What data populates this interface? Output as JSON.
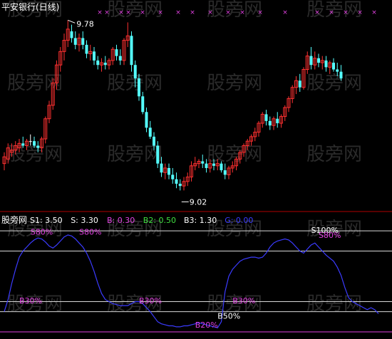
{
  "colors": {
    "background": "#000000",
    "up_candle": "#ff3030",
    "down_candle": "#54ffff",
    "doji": "#ffffff",
    "ind_line": "#3b3bff",
    "ref_line": "#d8d8d8",
    "magenta": "#e040e0",
    "separator": "#b00000",
    "watermark": "#2a2a2a"
  },
  "watermark_text": "股旁网",
  "chart_data": [
    {
      "type": "candlestick",
      "title": "平安银行(日线)",
      "annotations": {
        "high_label": "9.78",
        "low_label": "9.02"
      },
      "top_markers": "×",
      "candles": [
        {
          "o": 9.14,
          "h": 9.19,
          "l": 9.11,
          "c": 9.17
        },
        {
          "o": 9.16,
          "h": 9.23,
          "l": 9.14,
          "c": 9.21
        },
        {
          "o": 9.19,
          "h": 9.23,
          "l": 9.17,
          "c": 9.2
        },
        {
          "o": 9.2,
          "h": 9.24,
          "l": 9.18,
          "c": 9.22
        },
        {
          "o": 9.21,
          "h": 9.25,
          "l": 9.19,
          "c": 9.23
        },
        {
          "o": 9.23,
          "h": 9.26,
          "l": 9.21,
          "c": 9.22
        },
        {
          "o": 9.22,
          "h": 9.25,
          "l": 9.2,
          "c": 9.24
        },
        {
          "o": 9.24,
          "h": 9.27,
          "l": 9.22,
          "c": 9.24
        },
        {
          "o": 9.24,
          "h": 9.26,
          "l": 9.21,
          "c": 9.22
        },
        {
          "o": 9.22,
          "h": 9.24,
          "l": 9.19,
          "c": 9.21
        },
        {
          "o": 9.21,
          "h": 9.26,
          "l": 9.19,
          "c": 9.25
        },
        {
          "o": 9.25,
          "h": 9.35,
          "l": 9.23,
          "c": 9.34
        },
        {
          "o": 9.34,
          "h": 9.42,
          "l": 9.32,
          "c": 9.4
        },
        {
          "o": 9.4,
          "h": 9.52,
          "l": 9.38,
          "c": 9.5
        },
        {
          "o": 9.5,
          "h": 9.6,
          "l": 9.47,
          "c": 9.58
        },
        {
          "o": 9.58,
          "h": 9.66,
          "l": 9.55,
          "c": 9.64
        },
        {
          "o": 9.64,
          "h": 9.72,
          "l": 9.6,
          "c": 9.69
        },
        {
          "o": 9.69,
          "h": 9.78,
          "l": 9.66,
          "c": 9.74
        },
        {
          "o": 9.73,
          "h": 9.76,
          "l": 9.68,
          "c": 9.7
        },
        {
          "o": 9.7,
          "h": 9.73,
          "l": 9.65,
          "c": 9.67
        },
        {
          "o": 9.67,
          "h": 9.72,
          "l": 9.64,
          "c": 9.7
        },
        {
          "o": 9.7,
          "h": 9.73,
          "l": 9.65,
          "c": 9.67
        },
        {
          "o": 9.67,
          "h": 9.69,
          "l": 9.61,
          "c": 9.63
        },
        {
          "o": 9.63,
          "h": 9.67,
          "l": 9.6,
          "c": 9.64
        },
        {
          "o": 9.64,
          "h": 9.66,
          "l": 9.58,
          "c": 9.6
        },
        {
          "o": 9.6,
          "h": 9.62,
          "l": 9.56,
          "c": 9.58
        },
        {
          "o": 9.58,
          "h": 9.61,
          "l": 9.55,
          "c": 9.59
        },
        {
          "o": 9.59,
          "h": 9.62,
          "l": 9.56,
          "c": 9.58
        },
        {
          "o": 9.58,
          "h": 9.61,
          "l": 9.56,
          "c": 9.6
        },
        {
          "o": 9.6,
          "h": 9.66,
          "l": 9.58,
          "c": 9.65
        },
        {
          "o": 9.65,
          "h": 9.67,
          "l": 9.6,
          "c": 9.62
        },
        {
          "o": 9.62,
          "h": 9.65,
          "l": 9.58,
          "c": 9.6
        },
        {
          "o": 9.6,
          "h": 9.7,
          "l": 9.58,
          "c": 9.69
        },
        {
          "o": 9.69,
          "h": 9.77,
          "l": 9.66,
          "c": 9.71
        },
        {
          "o": 9.71,
          "h": 9.73,
          "l": 9.55,
          "c": 9.58
        },
        {
          "o": 9.58,
          "h": 9.6,
          "l": 9.48,
          "c": 9.52
        },
        {
          "o": 9.52,
          "h": 9.54,
          "l": 9.42,
          "c": 9.44
        },
        {
          "o": 9.44,
          "h": 9.46,
          "l": 9.36,
          "c": 9.37
        },
        {
          "o": 9.37,
          "h": 9.39,
          "l": 9.28,
          "c": 9.3
        },
        {
          "o": 9.3,
          "h": 9.33,
          "l": 9.25,
          "c": 9.26
        },
        {
          "o": 9.26,
          "h": 9.28,
          "l": 9.2,
          "c": 9.22
        },
        {
          "o": 9.22,
          "h": 9.24,
          "l": 9.12,
          "c": 9.14
        },
        {
          "o": 9.14,
          "h": 9.17,
          "l": 9.08,
          "c": 9.1
        },
        {
          "o": 9.1,
          "h": 9.14,
          "l": 9.07,
          "c": 9.12
        },
        {
          "o": 9.12,
          "h": 9.14,
          "l": 9.07,
          "c": 9.09
        },
        {
          "o": 9.09,
          "h": 9.12,
          "l": 9.05,
          "c": 9.07
        },
        {
          "o": 9.07,
          "h": 9.1,
          "l": 9.03,
          "c": 9.05
        },
        {
          "o": 9.05,
          "h": 9.07,
          "l": 9.02,
          "c": 9.04
        },
        {
          "o": 9.04,
          "h": 9.08,
          "l": 9.02,
          "c": 9.06
        },
        {
          "o": 9.06,
          "h": 9.1,
          "l": 9.04,
          "c": 9.08
        },
        {
          "o": 9.08,
          "h": 9.15,
          "l": 9.06,
          "c": 9.13
        },
        {
          "o": 9.13,
          "h": 9.17,
          "l": 9.11,
          "c": 9.14
        },
        {
          "o": 9.14,
          "h": 9.16,
          "l": 9.12,
          "c": 9.15
        },
        {
          "o": 9.15,
          "h": 9.18,
          "l": 9.12,
          "c": 9.14
        },
        {
          "o": 9.14,
          "h": 9.16,
          "l": 9.1,
          "c": 9.12
        },
        {
          "o": 9.12,
          "h": 9.16,
          "l": 9.1,
          "c": 9.14
        },
        {
          "o": 9.14,
          "h": 9.16,
          "l": 9.11,
          "c": 9.13
        },
        {
          "o": 9.13,
          "h": 9.16,
          "l": 9.11,
          "c": 9.14
        },
        {
          "o": 9.14,
          "h": 9.15,
          "l": 9.1,
          "c": 9.11
        },
        {
          "o": 9.11,
          "h": 9.14,
          "l": 9.07,
          "c": 9.09
        },
        {
          "o": 9.09,
          "h": 9.13,
          "l": 9.07,
          "c": 9.12
        },
        {
          "o": 9.12,
          "h": 9.15,
          "l": 9.1,
          "c": 9.13
        },
        {
          "o": 9.13,
          "h": 9.17,
          "l": 9.11,
          "c": 9.16
        },
        {
          "o": 9.16,
          "h": 9.2,
          "l": 9.14,
          "c": 9.19
        },
        {
          "o": 9.19,
          "h": 9.23,
          "l": 9.17,
          "c": 9.22
        },
        {
          "o": 9.22,
          "h": 9.25,
          "l": 9.2,
          "c": 9.24
        },
        {
          "o": 9.24,
          "h": 9.27,
          "l": 9.22,
          "c": 9.26
        },
        {
          "o": 9.26,
          "h": 9.3,
          "l": 9.24,
          "c": 9.28
        },
        {
          "o": 9.28,
          "h": 9.33,
          "l": 9.26,
          "c": 9.32
        },
        {
          "o": 9.32,
          "h": 9.37,
          "l": 9.3,
          "c": 9.36
        },
        {
          "o": 9.36,
          "h": 9.38,
          "l": 9.31,
          "c": 9.33
        },
        {
          "o": 9.33,
          "h": 9.35,
          "l": 9.29,
          "c": 9.31
        },
        {
          "o": 9.31,
          "h": 9.35,
          "l": 9.29,
          "c": 9.34
        },
        {
          "o": 9.34,
          "h": 9.37,
          "l": 9.3,
          "c": 9.32
        },
        {
          "o": 9.32,
          "h": 9.36,
          "l": 9.3,
          "c": 9.35
        },
        {
          "o": 9.35,
          "h": 9.4,
          "l": 9.33,
          "c": 9.39
        },
        {
          "o": 9.39,
          "h": 9.44,
          "l": 9.37,
          "c": 9.43
        },
        {
          "o": 9.43,
          "h": 9.49,
          "l": 9.41,
          "c": 9.48
        },
        {
          "o": 9.48,
          "h": 9.53,
          "l": 9.45,
          "c": 9.51
        },
        {
          "o": 9.51,
          "h": 9.54,
          "l": 9.46,
          "c": 9.48
        },
        {
          "o": 9.48,
          "h": 9.57,
          "l": 9.47,
          "c": 9.56
        },
        {
          "o": 9.56,
          "h": 9.64,
          "l": 9.54,
          "c": 9.62
        },
        {
          "o": 9.62,
          "h": 9.66,
          "l": 9.56,
          "c": 9.58
        },
        {
          "o": 9.58,
          "h": 9.64,
          "l": 9.56,
          "c": 9.61
        },
        {
          "o": 9.61,
          "h": 9.63,
          "l": 9.57,
          "c": 9.59
        },
        {
          "o": 9.59,
          "h": 9.62,
          "l": 9.56,
          "c": 9.6
        },
        {
          "o": 9.6,
          "h": 9.62,
          "l": 9.55,
          "c": 9.57
        },
        {
          "o": 9.57,
          "h": 9.6,
          "l": 9.54,
          "c": 9.59
        },
        {
          "o": 9.59,
          "h": 9.61,
          "l": 9.55,
          "c": 9.56
        },
        {
          "o": 9.56,
          "h": 9.59,
          "l": 9.53,
          "c": 9.55
        },
        {
          "o": 9.55,
          "h": 9.58,
          "l": 9.51,
          "c": 9.52
        }
      ]
    },
    {
      "type": "line",
      "name": "股旁网",
      "params": [
        {
          "label": "S1:",
          "value": "3.50",
          "color": "#ffffff"
        },
        {
          "label": "S:",
          "value": "3.30",
          "color": "#ffffff"
        },
        {
          "label": "B:",
          "value": "0.30",
          "color": "#e040e0"
        },
        {
          "label": "B2:",
          "value": "0.50",
          "color": "#40e040"
        },
        {
          "label": "B3:",
          "value": "1.30",
          "color": "#ffffff"
        },
        {
          "label": "G:",
          "value": "0.00",
          "color": "#3b3bff"
        }
      ],
      "ylim": [
        0,
        110
      ],
      "reference_lines": [
        {
          "value": 100,
          "label": "S100%",
          "color": "#d8d8d8"
        },
        {
          "value": 80,
          "label": "S80%",
          "color": "#d8d8d8"
        },
        {
          "value": 30,
          "label": "B30%",
          "color": "#d8d8d8"
        },
        {
          "value": 20,
          "label": "B20%",
          "color": "#d8d8d8"
        },
        {
          "value": 0,
          "label": "",
          "color": "#e040e0"
        }
      ],
      "series_values": [
        20,
        32,
        48,
        62,
        74,
        80,
        84,
        88,
        91,
        93,
        92,
        89,
        85,
        83,
        86,
        90,
        94,
        96,
        95,
        92,
        88,
        84,
        78,
        70,
        60,
        48,
        38,
        32,
        30,
        28,
        27,
        26,
        26,
        26,
        28,
        30,
        30,
        28,
        24,
        20,
        15,
        10,
        8,
        7,
        6,
        6,
        5,
        5,
        6,
        6,
        7,
        8,
        9,
        8,
        7,
        6,
        5,
        4,
        10,
        40,
        55,
        62,
        66,
        70,
        72,
        73,
        74,
        74,
        73,
        74,
        78,
        84,
        88,
        90,
        91,
        92,
        91,
        88,
        84,
        80,
        78,
        82,
        86,
        88,
        84,
        80,
        76,
        73,
        70,
        64,
        56,
        44,
        34,
        30,
        28,
        26,
        24,
        22,
        24,
        22,
        18
      ],
      "labels": [
        {
          "text": "S80%",
          "index": 7,
          "value": 99,
          "color": "#e040e0"
        },
        {
          "text": "S80%",
          "index": 20,
          "value": 99,
          "color": "#e040e0"
        },
        {
          "text": "S100%",
          "index": 82,
          "value": 101,
          "color": "#ffffff"
        },
        {
          "text": "S80%",
          "index": 84,
          "value": 96,
          "color": "#e040e0"
        },
        {
          "text": "B30%",
          "index": 4,
          "value": 31,
          "color": "#e040e0"
        },
        {
          "text": "B30%",
          "index": 36,
          "value": 31,
          "color": "#e040e0"
        },
        {
          "text": "B30%",
          "index": 61,
          "value": 31,
          "color": "#e040e0"
        },
        {
          "text": "B20%",
          "index": 51,
          "value": 7,
          "color": "#e040e0"
        },
        {
          "text": "B50%",
          "index": 57,
          "value": 16,
          "color": "#ffffff"
        }
      ]
    }
  ]
}
